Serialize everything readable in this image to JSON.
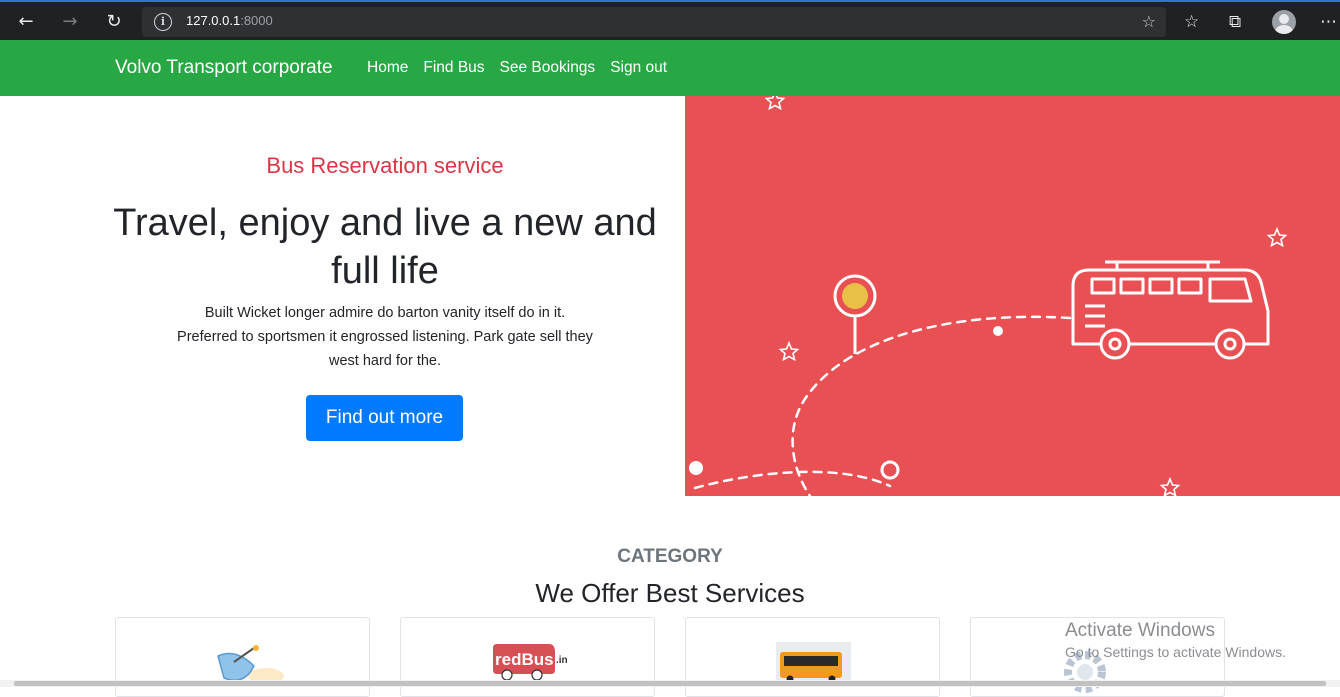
{
  "browser": {
    "url_host": "127.0.0.1",
    "url_port": ":8000",
    "info_symbol": "i"
  },
  "navbar": {
    "brand": "Volvo Transport corporate",
    "links": [
      "Home",
      "Find Bus",
      "See Bookings",
      "Sign out"
    ],
    "color": "#28a745"
  },
  "hero": {
    "subtitle": "Bus Reservation service",
    "headline": "Travel, enjoy and live a new and full life",
    "text": "Built Wicket longer admire do barton vanity itself do in it. Preferred to sportsmen it engrossed listening. Park gate sell they west hard for the.",
    "cta": "Find out more",
    "illustration_bg": "#e85053"
  },
  "category": {
    "label": "CATEGORY",
    "title": "We Offer Best Services",
    "cards": [
      {
        "icon": "satellite-dish-icon"
      },
      {
        "logo_text": "redBus",
        "logo_suffix": ".in"
      },
      {
        "icon": "bus-photo"
      },
      {
        "icon": "gear-icon"
      }
    ]
  },
  "watermark": {
    "line1": "Activate Windows",
    "line2": "Go to Settings to activate Windows."
  }
}
